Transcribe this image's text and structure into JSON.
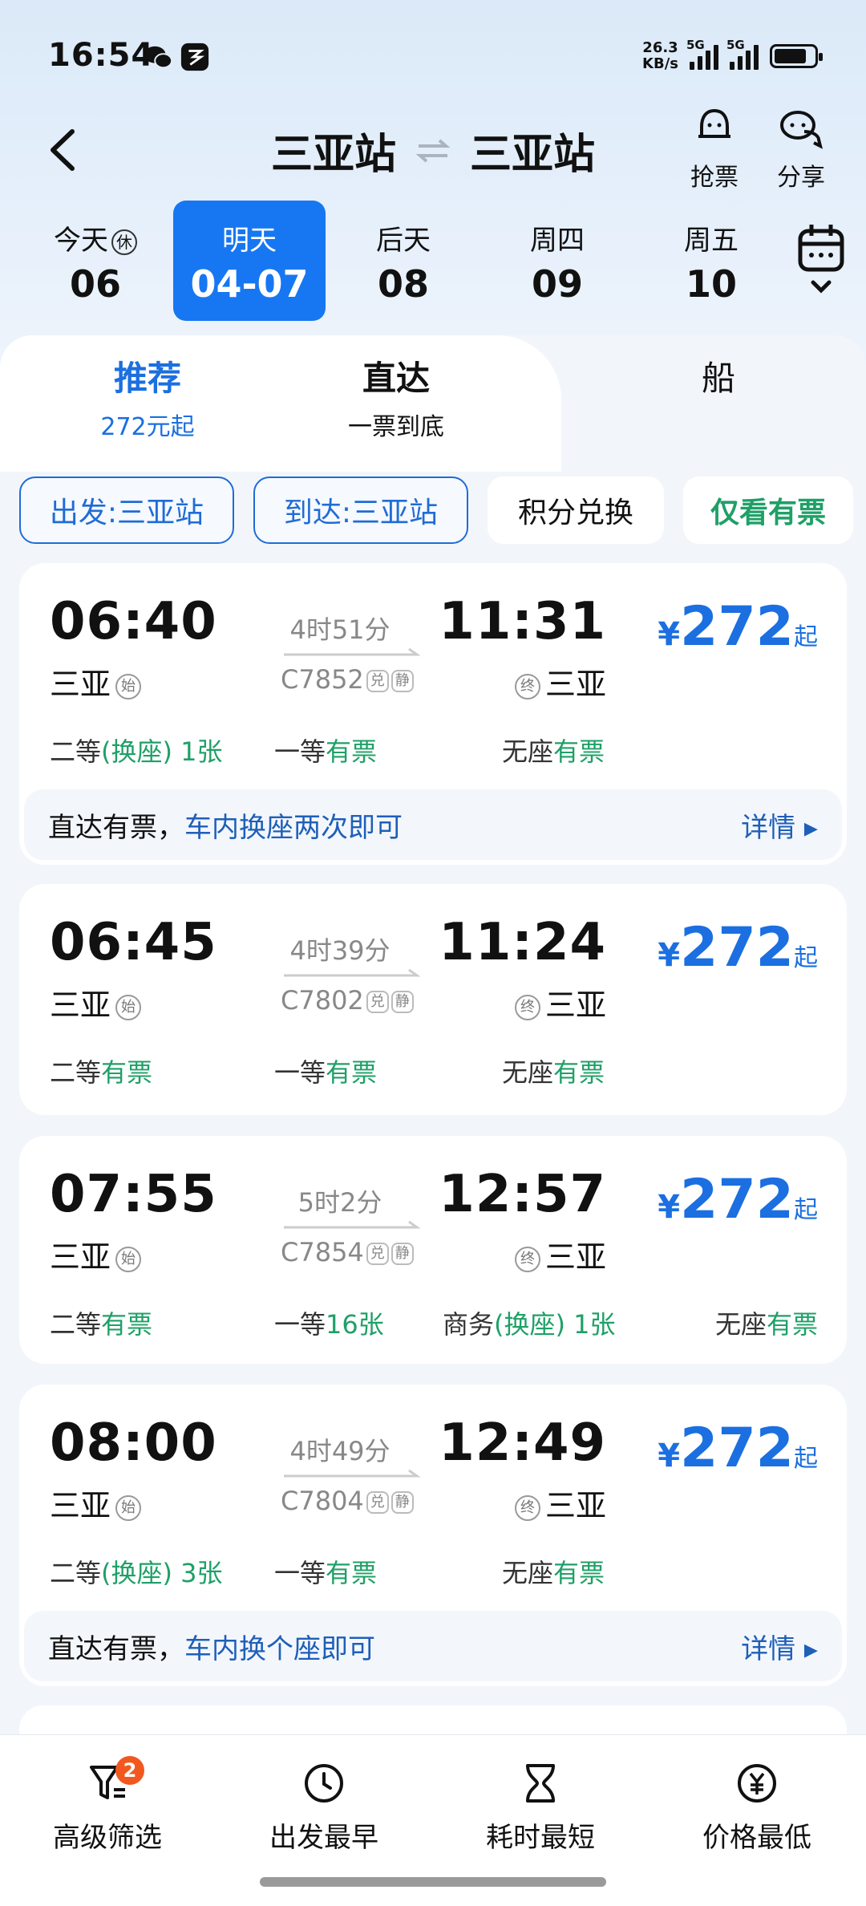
{
  "status_bar": {
    "time": "16:54",
    "net_speed_value": "26.3",
    "net_speed_unit": "KB/s",
    "signal1": "5G",
    "signal2": "5G"
  },
  "header": {
    "from_station": "三亚站",
    "to_station": "三亚站",
    "grab_label": "抢票",
    "share_label": "分享"
  },
  "dates": [
    {
      "label": "今天",
      "holiday": "休",
      "value": "06",
      "active": false
    },
    {
      "label": "明天",
      "value": "04-07",
      "active": true
    },
    {
      "label": "后天",
      "value": "08",
      "active": false
    },
    {
      "label": "周四",
      "value": "09",
      "active": false
    },
    {
      "label": "周五",
      "value": "10",
      "active": false
    }
  ],
  "tabs": [
    {
      "title": "推荐",
      "sub": "272元起",
      "active": true
    },
    {
      "title": "直达",
      "sub": "一票到底",
      "active": false
    },
    {
      "title": "船",
      "sub": "",
      "active": false
    }
  ],
  "filters": {
    "depart": "出发:三亚站",
    "arrive": "到达:三亚站",
    "points": "积分兑换",
    "only_available": "仅看有票"
  },
  "badges": {
    "start": "始",
    "end": "终",
    "exchange": "兑",
    "quiet": "静"
  },
  "trains": [
    {
      "dep_time": "06:40",
      "arr_time": "11:31",
      "duration": "4时51分",
      "train_no": "C7852",
      "from": "三亚",
      "to": "三亚",
      "price_symbol": "¥",
      "price": "272",
      "price_suffix": "起",
      "seats": [
        {
          "type": "二等",
          "extra": "(换座)",
          "status": " 1张"
        },
        {
          "type": "一等",
          "extra": "",
          "status": "有票"
        },
        {
          "type": "无座",
          "extra": "",
          "status": "有票"
        }
      ],
      "note": {
        "prefix": "直达有票，",
        "highlight": "车内换座两次即可",
        "detail": "详情"
      }
    },
    {
      "dep_time": "06:45",
      "arr_time": "11:24",
      "duration": "4时39分",
      "train_no": "C7802",
      "from": "三亚",
      "to": "三亚",
      "price_symbol": "¥",
      "price": "272",
      "price_suffix": "起",
      "seats": [
        {
          "type": "二等",
          "extra": "",
          "status": "有票"
        },
        {
          "type": "一等",
          "extra": "",
          "status": "有票"
        },
        {
          "type": "无座",
          "extra": "",
          "status": "有票"
        }
      ]
    },
    {
      "dep_time": "07:55",
      "arr_time": "12:57",
      "duration": "5时2分",
      "train_no": "C7854",
      "from": "三亚",
      "to": "三亚",
      "price_symbol": "¥",
      "price": "272",
      "price_suffix": "起",
      "seats": [
        {
          "type": "二等",
          "extra": "",
          "status": "有票"
        },
        {
          "type": "一等",
          "extra": "",
          "status": "16张"
        },
        {
          "type": "商务",
          "extra": "(换座)",
          "status": " 1张"
        },
        {
          "type": "无座",
          "extra": "",
          "status": "有票"
        }
      ]
    },
    {
      "dep_time": "08:00",
      "arr_time": "12:49",
      "duration": "4时49分",
      "train_no": "C7804",
      "from": "三亚",
      "to": "三亚",
      "price_symbol": "¥",
      "price": "272",
      "price_suffix": "起",
      "seats": [
        {
          "type": "二等",
          "extra": "(换座)",
          "status": " 3张"
        },
        {
          "type": "一等",
          "extra": "",
          "status": "有票"
        },
        {
          "type": "无座",
          "extra": "",
          "status": "有票"
        }
      ],
      "note": {
        "prefix": "直达有票，",
        "highlight": "车内换个座即可",
        "detail": "详情"
      }
    }
  ],
  "bottom_bar": {
    "filter_label": "高级筛选",
    "filter_badge": "2",
    "earliest_label": "出发最早",
    "shortest_label": "耗时最短",
    "cheapest_label": "价格最低"
  },
  "colors": {
    "accent": "#1777f2",
    "green": "#1fa067",
    "badge": "#f2581e"
  }
}
